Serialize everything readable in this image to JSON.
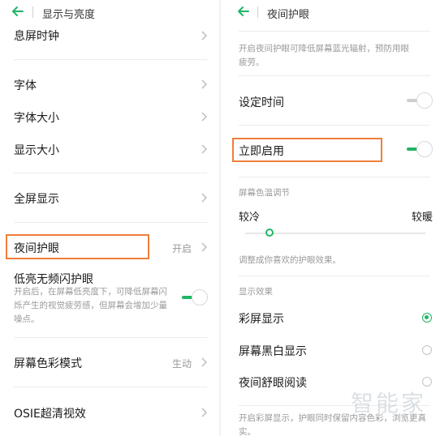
{
  "left": {
    "title": "显示与亮度",
    "items": [
      {
        "label": "息屏时钟"
      },
      {
        "label": "字体"
      },
      {
        "label": "字体大小"
      },
      {
        "label": "显示大小"
      },
      {
        "label": "全屏显示"
      },
      {
        "label": "夜间护眼",
        "value": "开启"
      },
      {
        "label": "低亮无频闪护眼",
        "desc": "开启后，在屏幕低亮度下，可降低屏幕闪烁产生的视觉疲劳感，但屏幕会增加少量噪点。",
        "toggle": true
      },
      {
        "label": "屏幕色彩模式",
        "value": "生动"
      },
      {
        "label": "OSIE超清视效"
      }
    ]
  },
  "right": {
    "title": "夜间护眼",
    "intro": "开启夜间护眼可降低屏幕蓝光辐射，预防用眼疲劳。",
    "schedule_label": "设定时间",
    "schedule_toggle": false,
    "enable_now_label": "立即启用",
    "enable_now_toggle": true,
    "temperature": {
      "section": "屏幕色温调节",
      "cool": "较冷",
      "warm": "较暖",
      "hint": "调整成你喜欢的护眼效果。",
      "level": 0.12
    },
    "display_effect": {
      "section": "显示效果",
      "options": [
        "彩屏显示",
        "屏幕黑白显示",
        "夜间舒眼阅读"
      ],
      "selected": 0
    },
    "footer_hint": "开启彩屏显示，护眼同时保留内容色彩，浏览更真实。"
  },
  "watermark": "智能家",
  "colors": {
    "accent": "#21b565",
    "highlight": "#f07f3a"
  }
}
